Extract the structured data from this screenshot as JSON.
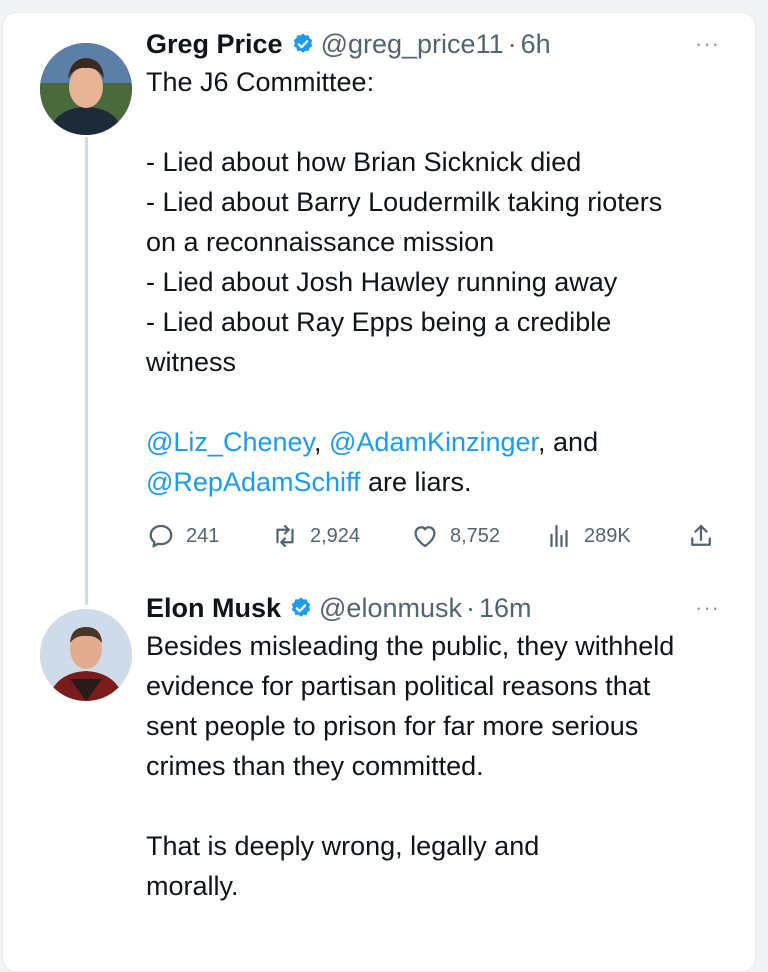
{
  "thread": {
    "tweets": [
      {
        "name": "Greg Price",
        "handle": "@greg_price11",
        "separator": "·",
        "time": "6h",
        "more": "···",
        "lines": [
          "The J6 Committee:",
          "",
          "- Lied about how Brian Sicknick died",
          "- Lied about Barry Loudermilk taking rioters on a reconnaissance mission",
          "- Lied about Josh Hawley running away",
          "- Lied about Ray Epps being a credible witness",
          ""
        ],
        "mention1": "@Liz_Cheney",
        "comma1": ", ",
        "mention2": "@AdamKinzinger",
        "comma2": ", and ",
        "mention3": "@RepAdamSchiff",
        "tail": " are liars.",
        "actions": {
          "replies": "241",
          "retweets": "2,924",
          "likes": "8,752",
          "views": "289K"
        }
      },
      {
        "name": "Elon Musk",
        "handle": "@elonmusk",
        "separator": "·",
        "time": "16m",
        "more": "···",
        "para1": "Besides misleading the public, they withheld evidence for partisan political reasons that sent people to prison for far more serious crimes than they committed.",
        "para2": "That is deeply wrong, legally and morally."
      }
    ]
  },
  "colors": {
    "link": "#1d9bf0",
    "verified": "#1d9bf0",
    "muted": "#536471",
    "text": "#0f1419"
  },
  "icons": [
    "verified-badge-icon",
    "more-icon",
    "reply-icon",
    "retweet-icon",
    "like-icon",
    "views-icon",
    "share-icon"
  ]
}
